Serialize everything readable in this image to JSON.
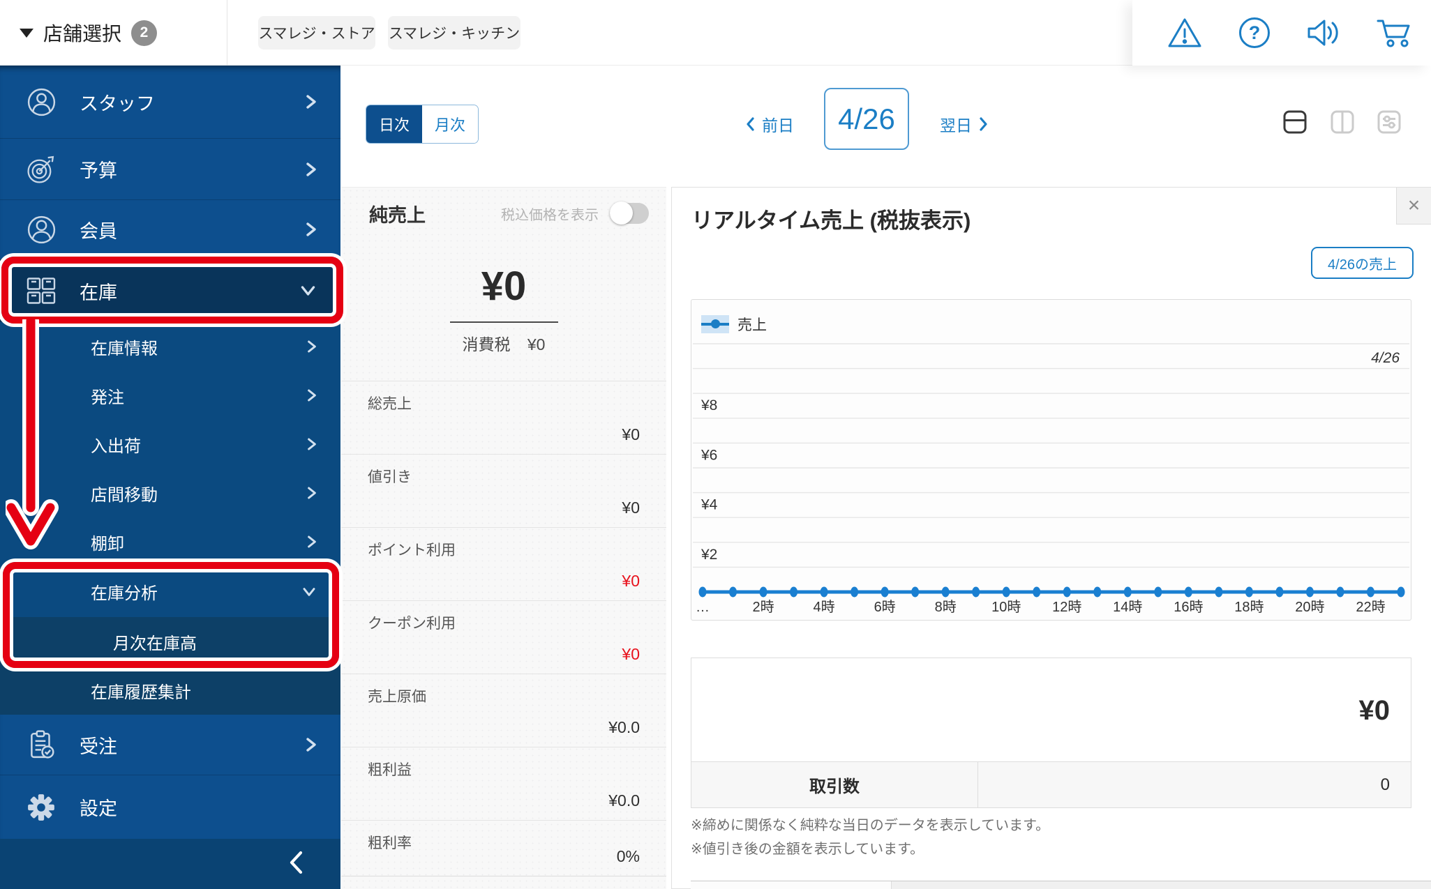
{
  "header": {
    "store_selector_label": "店舗選択",
    "store_count_badge": "2",
    "tabs": [
      {
        "label": "スマレジ・ストア"
      },
      {
        "label": "スマレジ・キッチン"
      }
    ],
    "icons": [
      "alert-icon",
      "help-icon",
      "announcement-icon",
      "cart-icon"
    ]
  },
  "sidebar": {
    "items": [
      {
        "label": "スタッフ"
      },
      {
        "label": "予算"
      },
      {
        "label": "会員"
      },
      {
        "label": "在庫"
      },
      {
        "label": "在庫情報"
      },
      {
        "label": "発注"
      },
      {
        "label": "入出荷"
      },
      {
        "label": "店間移動"
      },
      {
        "label": "棚卸"
      },
      {
        "label": "在庫分析"
      },
      {
        "label": "月次在庫高"
      },
      {
        "label": "在庫履歴集計"
      },
      {
        "label": "受注"
      },
      {
        "label": "設定"
      }
    ]
  },
  "toolbar": {
    "daily_label": "日次",
    "monthly_label": "月次",
    "prev_label": "前日",
    "date_value": "4/26",
    "next_label": "翌日"
  },
  "sales_panel": {
    "title": "純売上",
    "tax_toggle_label": "税込価格を表示",
    "net_amount": "¥0",
    "tax_label": "消費税",
    "tax_value": "¥0",
    "rows": [
      {
        "label": "総売上",
        "value": "¥0",
        "red": false
      },
      {
        "label": "値引き",
        "value": "¥0",
        "red": false
      },
      {
        "label": "ポイント利用",
        "value": "¥0",
        "red": true
      },
      {
        "label": "クーポン利用",
        "value": "¥0",
        "red": true
      },
      {
        "label": "売上原価",
        "value": "¥0.0",
        "red": false
      },
      {
        "label": "粗利益",
        "value": "¥0.0",
        "red": false
      },
      {
        "label": "粗利率",
        "value": "0%",
        "red": false
      }
    ]
  },
  "realtime_panel": {
    "title": "リアルタイム売上 (税抜表示)",
    "close_label": "×",
    "date_sales_button": "4/26の売上",
    "total_amount": "¥0",
    "transactions_label": "取引数",
    "transactions_value": "0",
    "notes": [
      "※締めに関係なく純粋な当日のデータを表示しています。",
      "※値引き後の金額を表示しています。"
    ]
  },
  "chart_data": {
    "type": "line",
    "title": "リアルタイム売上 (税抜表示)",
    "legend": [
      "売上"
    ],
    "legend_position": "top-left",
    "annotation": "4/26",
    "grid": true,
    "x": [
      0,
      1,
      2,
      3,
      4,
      5,
      6,
      7,
      8,
      9,
      10,
      11,
      12,
      13,
      14,
      15,
      16,
      17,
      18,
      19,
      20,
      21,
      22,
      23
    ],
    "series": [
      {
        "name": "売上",
        "values": [
          0,
          0,
          0,
          0,
          0,
          0,
          0,
          0,
          0,
          0,
          0,
          0,
          0,
          0,
          0,
          0,
          0,
          0,
          0,
          0,
          0,
          0,
          0,
          0
        ]
      }
    ],
    "x_tick_positions": [
      0,
      2,
      4,
      6,
      8,
      10,
      12,
      14,
      16,
      18,
      20,
      22
    ],
    "x_tick_labels": [
      "…",
      "2時",
      "4時",
      "6時",
      "8時",
      "10時",
      "12時",
      "14時",
      "16時",
      "18時",
      "20時",
      "22時"
    ],
    "y_ticks": [
      {
        "label": "¥8",
        "value": 8
      },
      {
        "label": "¥6",
        "value": 6
      },
      {
        "label": "¥4",
        "value": 4
      },
      {
        "label": "¥2",
        "value": 2
      }
    ],
    "ylim": [
      0,
      10
    ]
  },
  "colors": {
    "accent_blue": "#1b7ec5",
    "sidebar_blue": "#0d4f8e",
    "sidebar_selected": "#09345a",
    "annotation_red": "#e50012",
    "negative_value_red": "#e8121d"
  }
}
